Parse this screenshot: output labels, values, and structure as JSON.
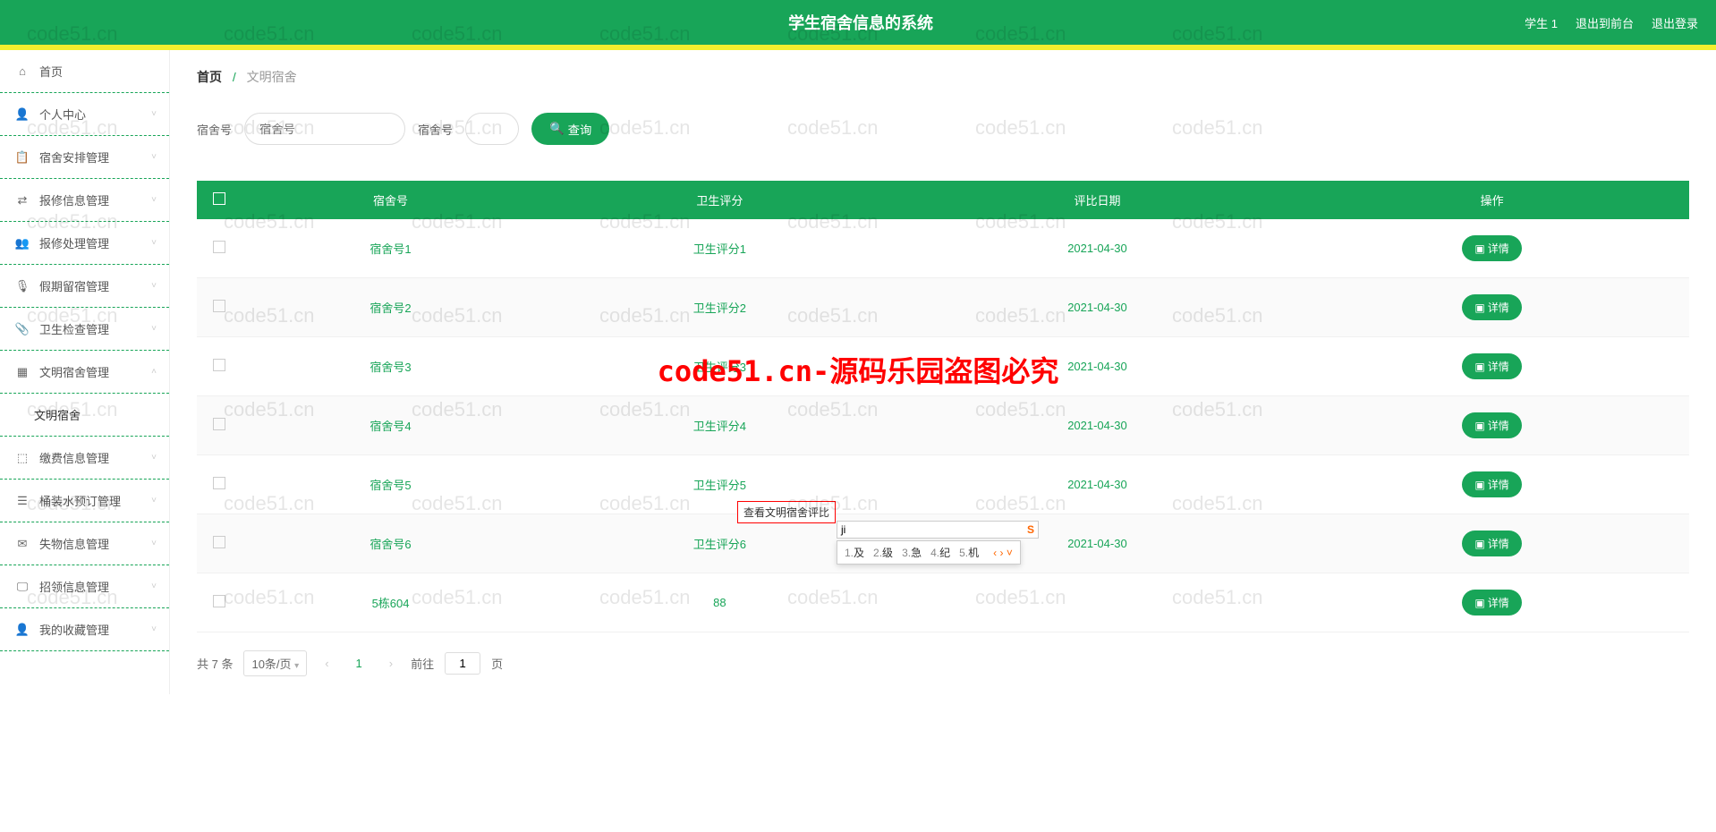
{
  "header": {
    "title": "学生宿舍信息的系统",
    "user": "学生 1",
    "toFront": "退出到前台",
    "logout": "退出登录"
  },
  "sidebar": {
    "items": [
      {
        "icon": "home",
        "label": "首页",
        "expandable": false
      },
      {
        "icon": "user",
        "label": "个人中心",
        "expandable": true
      },
      {
        "icon": "list",
        "label": "宿舍安排管理",
        "expandable": true
      },
      {
        "icon": "tool",
        "label": "报修信息管理",
        "expandable": true
      },
      {
        "icon": "user2",
        "label": "报修处理管理",
        "expandable": true
      },
      {
        "icon": "mic",
        "label": "假期留宿管理",
        "expandable": true
      },
      {
        "icon": "clip",
        "label": "卫生检查管理",
        "expandable": true
      },
      {
        "icon": "doc",
        "label": "文明宿舍管理",
        "expandable": true,
        "expanded": true,
        "sub": "文明宿舍"
      },
      {
        "icon": "scan",
        "label": "缴费信息管理",
        "expandable": true
      },
      {
        "icon": "menu",
        "label": "桶装水预订管理",
        "expandable": true
      },
      {
        "icon": "mail",
        "label": "失物信息管理",
        "expandable": true
      },
      {
        "icon": "screen",
        "label": "招领信息管理",
        "expandable": true
      },
      {
        "icon": "star",
        "label": "我的收藏管理",
        "expandable": true
      }
    ]
  },
  "breadcrumb": {
    "home": "首页",
    "current": "文明宿舍"
  },
  "search": {
    "label1": "宿舍号",
    "label2": "宿舍号",
    "btn": "查询"
  },
  "table": {
    "headers": [
      "",
      "宿舍号",
      "卫生评分",
      "评比日期",
      "操作"
    ],
    "detailBtn": "详情",
    "rows": [
      {
        "dorm": "宿舍号1",
        "score": "卫生评分1",
        "date": "2021-04-30"
      },
      {
        "dorm": "宿舍号2",
        "score": "卫生评分2",
        "date": "2021-04-30"
      },
      {
        "dorm": "宿舍号3",
        "score": "卫生评分3",
        "date": "2021-04-30"
      },
      {
        "dorm": "宿舍号4",
        "score": "卫生评分4",
        "date": "2021-04-30"
      },
      {
        "dorm": "宿舍号5",
        "score": "卫生评分5",
        "date": "2021-04-30"
      },
      {
        "dorm": "宿舍号6",
        "score": "卫生评分6",
        "date": "2021-04-30"
      },
      {
        "dorm": "5栋604",
        "score": "88",
        "date": ""
      }
    ]
  },
  "pagination": {
    "total": "共 7 条",
    "perPage": "10条/页",
    "current": "1",
    "goto": "前往",
    "pageInput": "1",
    "pageUnit": "页"
  },
  "tooltip": {
    "text": "查看文明宿舍评比"
  },
  "ime": {
    "input": "ji",
    "candidates": [
      {
        "n": "1.",
        "c": "及"
      },
      {
        "n": "2.",
        "c": "级"
      },
      {
        "n": "3.",
        "c": "急"
      },
      {
        "n": "4.",
        "c": "纪"
      },
      {
        "n": "5.",
        "c": "机"
      }
    ]
  },
  "watermark": {
    "text": "code51.cn",
    "big": "code51.cn-源码乐园盗图必究"
  }
}
